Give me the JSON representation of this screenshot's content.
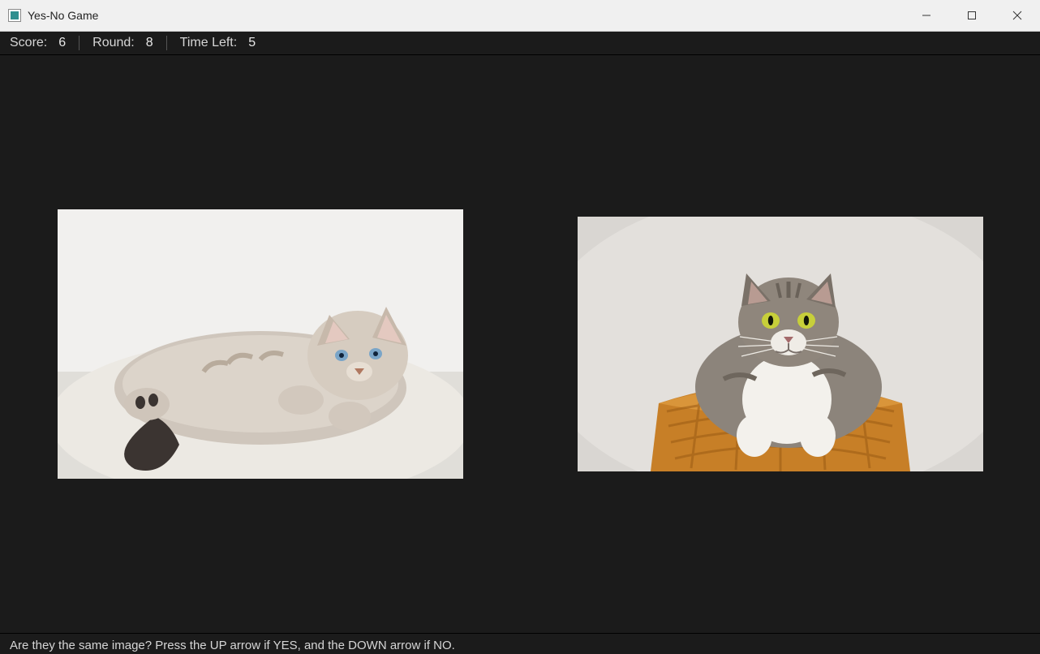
{
  "window": {
    "title": "Yes-No Game"
  },
  "status": {
    "score_label": "Score:",
    "score_value": "6",
    "round_label": "Round:",
    "round_value": "8",
    "time_label": "Time Left:",
    "time_value": "5"
  },
  "images": {
    "left_alt": "kitten lying on white blanket",
    "right_alt": "grey-and-white cat sitting in wicker basket"
  },
  "prompt": {
    "text": "Are they the same image? Press the UP arrow if YES, and the DOWN arrow if NO."
  }
}
